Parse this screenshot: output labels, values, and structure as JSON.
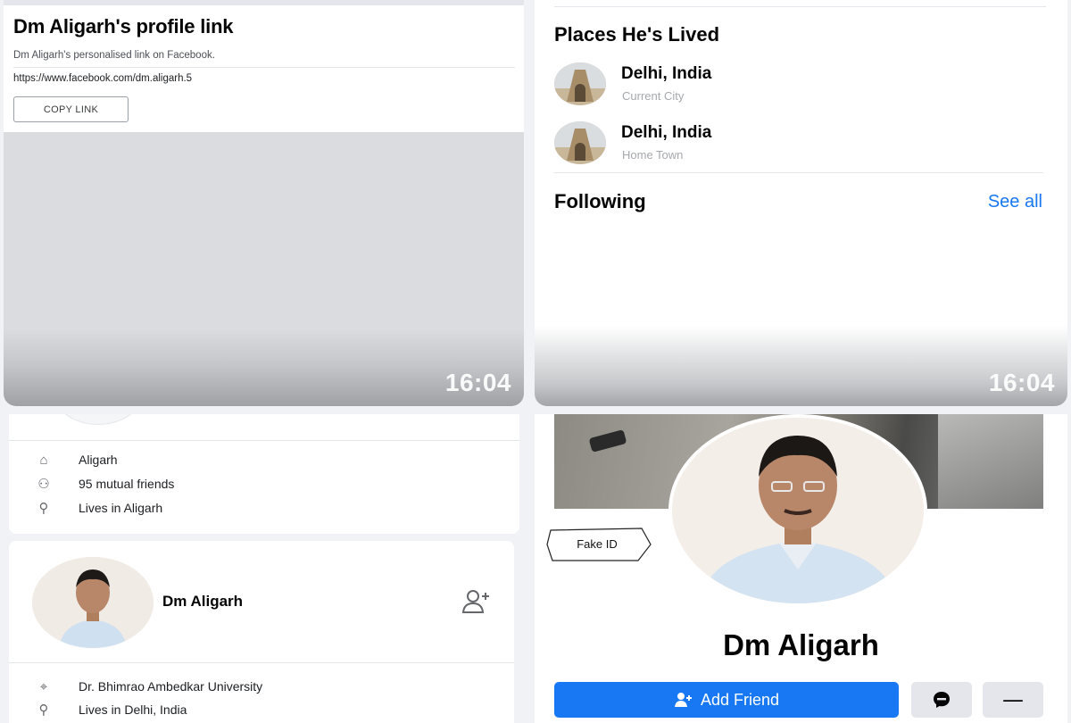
{
  "profile_link_panel": {
    "title": "Dm Aligarh's profile link",
    "subtitle": "Dm Aligarh's personalised link on Facebook.",
    "url": "https://www.facebook.com/dm.aligarh.5",
    "copy_label": "COPY LINK",
    "clock": "16:04"
  },
  "about_panel": {
    "places_heading": "Places He's Lived",
    "places": [
      {
        "name": "Delhi, India",
        "kind": "Current City"
      },
      {
        "name": "Delhi, India",
        "kind": "Home Town"
      }
    ],
    "following_heading": "Following",
    "see_all": "See all",
    "clock": "16:04"
  },
  "search_results": {
    "first_card": {
      "rows": [
        {
          "icon": "work-icon",
          "glyph": "⌂",
          "text": "Aligarh"
        },
        {
          "icon": "friends-icon",
          "glyph": "⚇",
          "text": "95 mutual friends"
        },
        {
          "icon": "location-icon",
          "glyph": "⚲",
          "text": "Lives in Aligarh"
        }
      ]
    },
    "second_card": {
      "name": "Dm Aligarh",
      "rows": [
        {
          "icon": "education-icon",
          "glyph": "⌖",
          "text": "Dr. Bhimrao Ambedkar University"
        },
        {
          "icon": "location-icon",
          "glyph": "⚲",
          "text": "Lives in Delhi, India"
        }
      ]
    }
  },
  "profile_page": {
    "name": "Dm Aligarh",
    "annotation": "Fake ID",
    "add_friend_label": "Add Friend",
    "more_label": "—"
  },
  "colors": {
    "primary": "#1877f2",
    "secondary_button": "#e4e6eb",
    "muted_text": "#65676b"
  }
}
